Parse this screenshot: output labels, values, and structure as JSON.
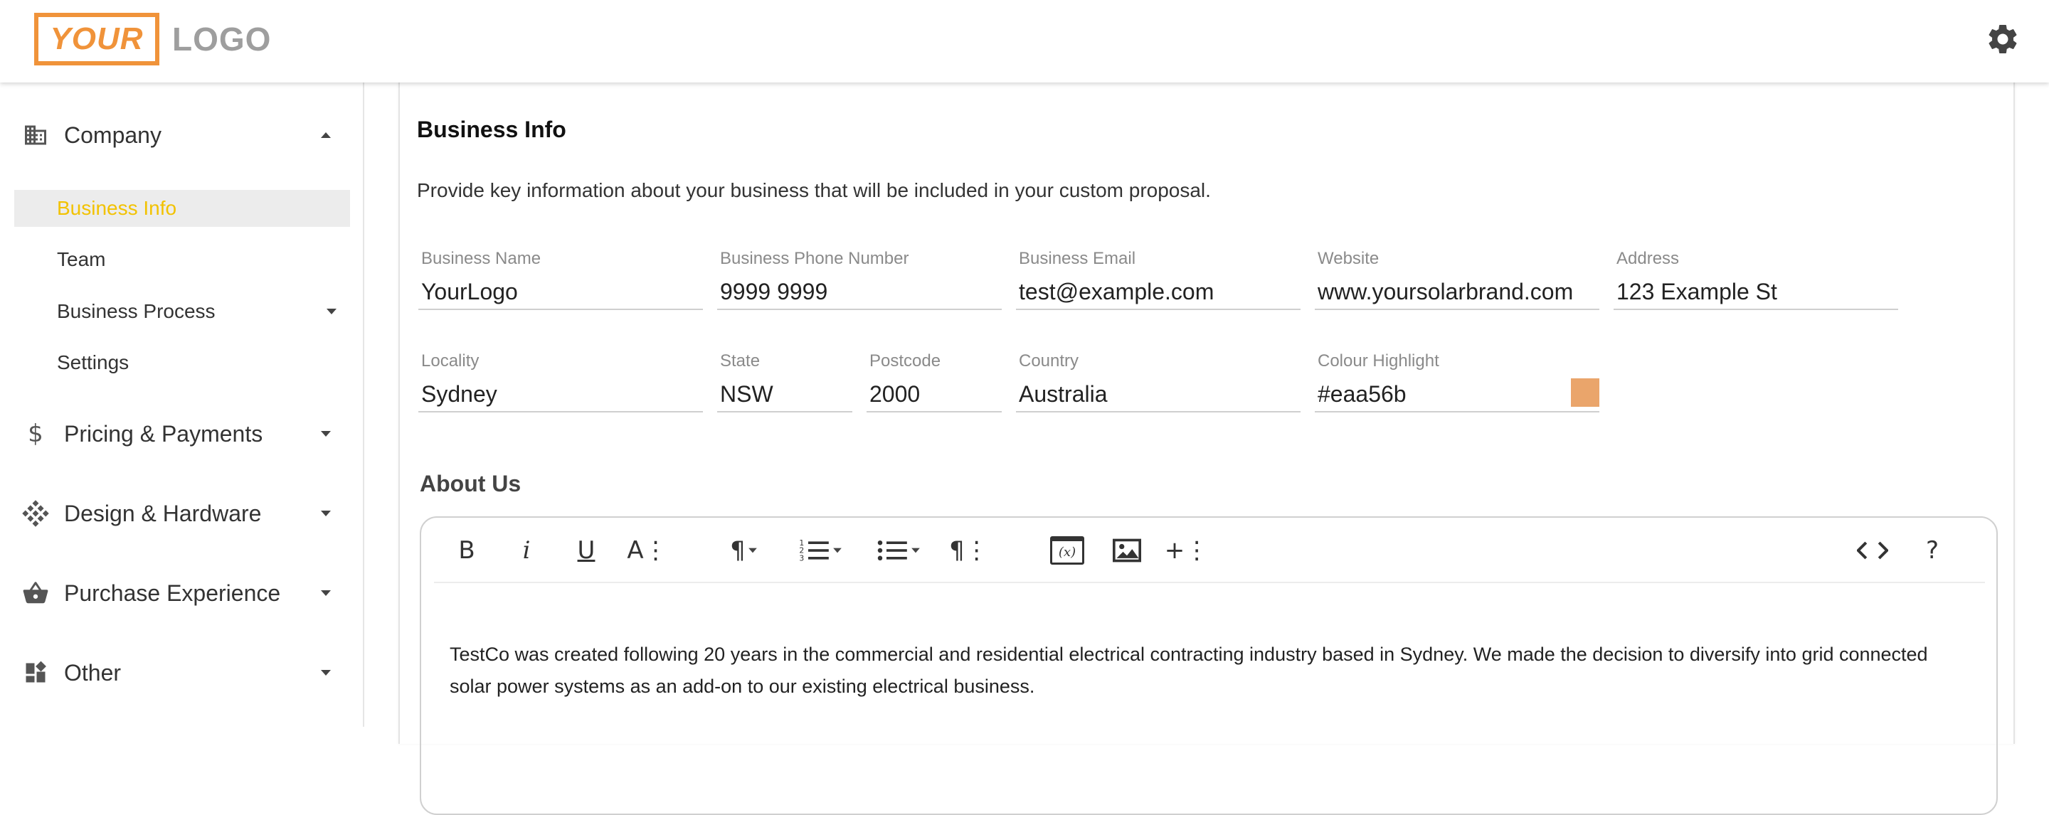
{
  "header": {
    "logo_boxed": "YOUR",
    "logo_text": "LOGO",
    "settings_icon": "gear-icon"
  },
  "sidebar": {
    "sections": [
      {
        "label": "Company",
        "icon": "building-icon",
        "expanded": true
      },
      {
        "label": "Pricing & Payments",
        "icon": "dollar-icon",
        "expanded": false
      },
      {
        "label": "Design & Hardware",
        "icon": "grid-diamond-icon",
        "expanded": false
      },
      {
        "label": "Purchase Experience",
        "icon": "basket-icon",
        "expanded": false
      },
      {
        "label": "Other",
        "icon": "dashboard-icon",
        "expanded": false
      }
    ],
    "company_items": [
      {
        "label": "Business Info",
        "active": true
      },
      {
        "label": "Team",
        "active": false
      },
      {
        "label": "Business Process",
        "active": false,
        "has_dropdown": true
      },
      {
        "label": "Settings",
        "active": false
      }
    ]
  },
  "main": {
    "title": "Business Info",
    "description": "Provide key information about your business that will be included in your custom proposal.",
    "fields": {
      "business_name": {
        "label": "Business Name",
        "value": "YourLogo"
      },
      "business_phone": {
        "label": "Business Phone Number",
        "value": "9999 9999"
      },
      "business_email": {
        "label": "Business Email",
        "value": "test@example.com"
      },
      "website": {
        "label": "Website",
        "value": "www.yoursolarbrand.com"
      },
      "address": {
        "label": "Address",
        "value": "123 Example St"
      },
      "locality": {
        "label": "Locality",
        "value": "Sydney"
      },
      "state": {
        "label": "State",
        "value": "NSW"
      },
      "postcode": {
        "label": "Postcode",
        "value": "2000"
      },
      "country": {
        "label": "Country",
        "value": "Australia"
      },
      "colour_highlight": {
        "label": "Colour Highlight",
        "value": "#eaa56b"
      }
    },
    "about_title": "About Us",
    "editor": {
      "toolbar": [
        "bold-icon",
        "italic-icon",
        "underline-icon",
        "font-size-icon",
        "paragraph-format-icon",
        "ordered-list-icon",
        "unordered-list-icon",
        "paragraph-style-icon",
        "insert-variable-icon",
        "insert-image-icon",
        "more-insert-icon",
        "code-view-icon",
        "help-icon"
      ],
      "variable_label": "(x)",
      "content": "TestCo was created following 20 years in the commercial and residential electrical contracting industry based in Sydney. We made the decision to diversify into grid connected solar power systems as an add-on to our existing electrical business."
    }
  },
  "colors": {
    "accent": "#f0933a",
    "active_text": "#f2c200",
    "swatch": "#eaa56b"
  }
}
